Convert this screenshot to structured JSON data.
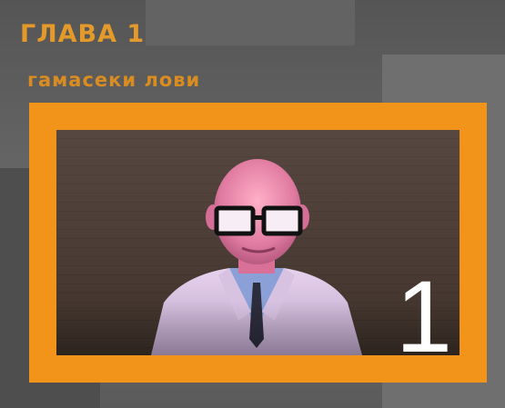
{
  "chapter": {
    "title": "ГЛАВА 1",
    "subtitle": "гамасеки лови",
    "number": "1"
  },
  "colors": {
    "accent": "#f2941a",
    "title_text": "#e39a2a",
    "background": "#5f5f5f",
    "number_text": "#ffffff"
  },
  "icons": {
    "portrait": "scientist-portrait-icon"
  }
}
